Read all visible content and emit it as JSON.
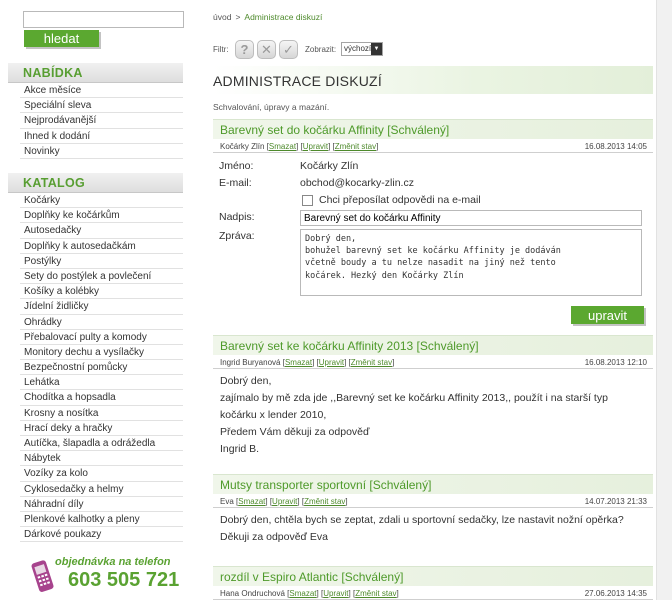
{
  "search": {
    "placeholder": "",
    "button_label": "hledat"
  },
  "menu": {
    "heading": "NABÍDKA",
    "items": [
      "Akce měsíce",
      "Speciální sleva",
      "Nejprodávanější",
      "Ihned k dodání",
      "Novinky"
    ]
  },
  "catalog": {
    "heading": "KATALOG",
    "items": [
      "Kočárky",
      "Doplňky ke kočárkům",
      "Autosedačky",
      "Doplňky k autosedačkám",
      "Postýlky",
      "Sety do postýlek a povlečení",
      "Košíky a kolébky",
      "Jídelní židličky",
      "Ohrádky",
      "Přebalovací pulty a komody",
      "Monitory dechu a vysílačky",
      "Bezpečnostní pomůcky",
      "Lehátka",
      "Chodítka a hopsadla",
      "Krosny a nosítka",
      "Hrací deky a hračky",
      "Autíčka, šlapadla a odrážedla",
      "Nábytek",
      "Vozíky za kolo",
      "Cyklosedačky a helmy",
      "Náhradní díly",
      "Plenkové kalhotky a pleny",
      "Dárkové poukazy"
    ]
  },
  "phone": {
    "label": "objednávka na telefon",
    "number": "603 505 721",
    "icon": "mobile-phone-icon"
  },
  "breadcrumb": {
    "home": "úvod",
    "separator": ">",
    "current": "Administrace diskuzí"
  },
  "filter": {
    "label": "Filtr:",
    "icons": [
      "question-icon",
      "x-icon",
      "check-icon"
    ],
    "show_label": "Zobrazit:",
    "show_value": "výchozí"
  },
  "page": {
    "title": "ADMINISTRACE DISKUZÍ",
    "subtitle": "Schvalování, úpravy a mazání."
  },
  "actions": {
    "delete": "Smazat",
    "edit": "Upravit",
    "change_state": "Změnit stav"
  },
  "posts": [
    {
      "title": "Barevný set do kočárku Affinity [Schválený]",
      "author": "Kočárky Zlín",
      "date": "16.08.2013 14:05",
      "form": {
        "name_label": "Jméno:",
        "name": "Kočárky Zlín",
        "email_label": "E-mail:",
        "email": "obchod@kocarky-zlin.cz",
        "forward_label": "Chci přeposílat odpovědi na e-mail",
        "subject_label": "Nadpis:",
        "subject": "Barevný set do kočárku Affinity",
        "message_label": "Zpráva:",
        "message": "Dobrý den,\nbohužel barevný set ke kočárku Affinity je dodáván\nvčetně boudy a tu nelze nasadit na jiný než tento\nkočárek. Hezký den Kočárky Zlín",
        "submit": "upravit"
      }
    },
    {
      "title": "Barevný set ke kočárku Affinity 2013 [Schválený]",
      "author": "Ingrid Buryanová",
      "date": "16.08.2013 12:10",
      "body": [
        "Dobrý den,",
        "zajímalo by mě zda jde ,,Barevný set ke kočárku Affinity 2013,, použít i na starší typ",
        "kočárku x lender 2010,",
        "Předem Vám děkuji za odpověď",
        "Ingrid B."
      ]
    },
    {
      "title": "Mutsy transporter sportovní [Schválený]",
      "author": "Eva",
      "date": "14.07.2013 21:33",
      "body": [
        "Dobrý den, chtěla bych se zeptat, zdali u sportovní sedačky, lze nastavit nožní opěrka?",
        "Děkuji za odpověď Eva"
      ]
    },
    {
      "title": "rozdíl v Espiro Atlantic [Schválený]",
      "author": "Hana Ondruchová",
      "date": "27.06.2013 14:35"
    }
  ]
}
